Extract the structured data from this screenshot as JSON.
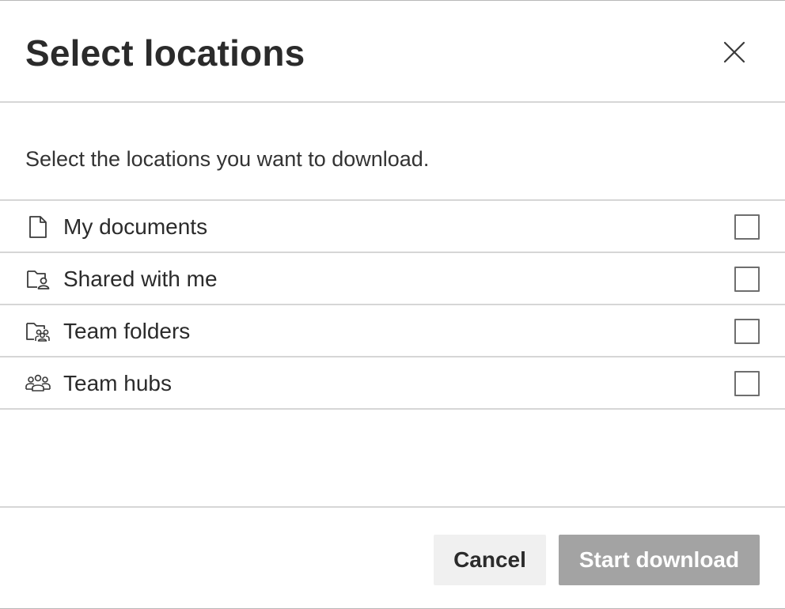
{
  "dialog": {
    "title": "Select locations",
    "close_icon": "close-icon",
    "description": "Select the locations you want to download."
  },
  "locations": [
    {
      "label": "My documents",
      "icon": "document-icon",
      "checked": false
    },
    {
      "label": "Shared with me",
      "icon": "shared-folder-icon",
      "checked": false
    },
    {
      "label": "Team folders",
      "icon": "team-folder-icon",
      "checked": false
    },
    {
      "label": "Team hubs",
      "icon": "team-hubs-icon",
      "checked": false
    }
  ],
  "footer": {
    "cancel_label": "Cancel",
    "start_label": "Start download",
    "start_enabled": false
  },
  "colors": {
    "primary_disabled": "#a3a3a3",
    "secondary_button": "#f0f0f0",
    "divider": "#d6d6d6",
    "text": "#2b2b2b"
  }
}
